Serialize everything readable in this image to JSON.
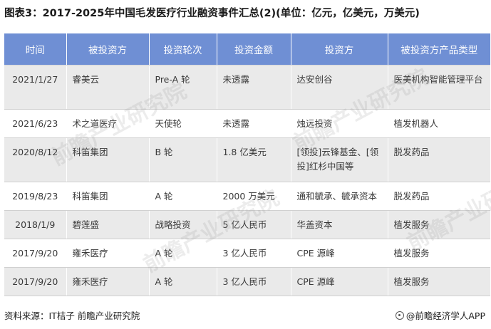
{
  "title": "图表3：2017-2025年中国毛发医疗行业融资事件汇总(2)(单位：亿元，亿美元，万美元)",
  "columns": [
    "时间",
    "被投资方",
    "投资轮次",
    "投资金额",
    "投资方",
    "被投资方产品类型"
  ],
  "rows": [
    {
      "date": "2021/1/27",
      "company": "睿美云",
      "round": "Pre-A 轮",
      "amount": "未透露",
      "investor": "达安创谷",
      "product": "医美机构智能管理平台"
    },
    {
      "date": "2021/6/23",
      "company": "术之道医疗",
      "round": "天使轮",
      "amount": "未透露",
      "investor": "烛远投资",
      "product": "植发机器人"
    },
    {
      "date": "2020/8/12",
      "company": "科笛集团",
      "round": "B 轮",
      "amount": "1.8 亿美元",
      "investor": "[领投]云锋基金、[领投]红杉中国等",
      "product": "脱发药品"
    },
    {
      "date": "2019/8/23",
      "company": "科笛集团",
      "round": "A 轮",
      "amount": "2000 万美元",
      "investor": "通和毓承、毓承资本",
      "product": "脱发药品"
    },
    {
      "date": "2018/1/9",
      "company": "碧莲盛",
      "round": "战略投资",
      "amount": "5 亿人民币",
      "investor": "华盖资本",
      "product": "植发服务"
    },
    {
      "date": "2017/9/20",
      "company": "雍禾医疗",
      "round": "A 轮",
      "amount": "3 亿人民币",
      "investor": "CPE 源峰",
      "product": "植发服务"
    },
    {
      "date": "2017/9/20",
      "company": "雍禾医疗",
      "round": "A 轮",
      "amount": "3 亿人民币",
      "investor": "CPE 源峰",
      "product": "植发服务"
    }
  ],
  "footer": {
    "source": "资料来源：IT桔子 前瞻产业研究院",
    "brand": "@前瞻经济学人APP"
  },
  "watermark": "前瞻产业研究院",
  "colors": {
    "header_bg": "#6f8fd4",
    "row_alt": "#eaeaea"
  }
}
